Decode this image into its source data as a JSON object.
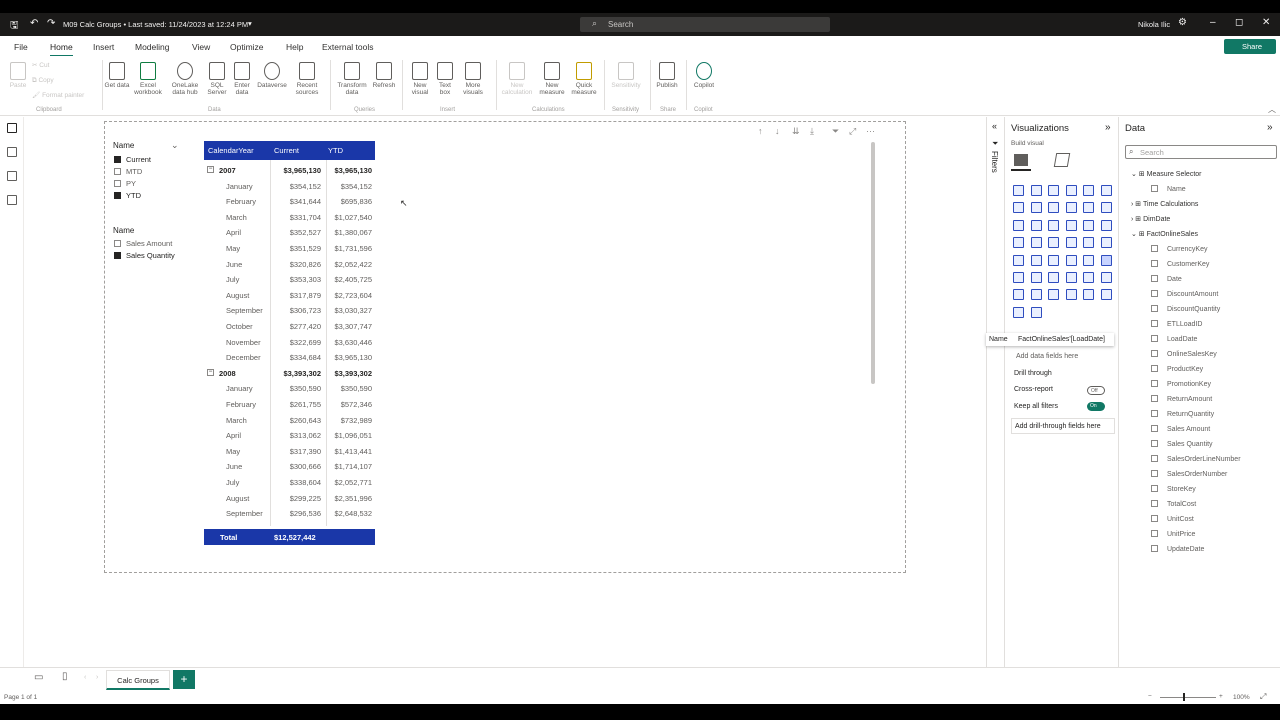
{
  "titlebar": {
    "file_title": "M09 Calc Groups • Last saved: 11/24/2023 at 12:24 PM",
    "search_placeholder": "Search",
    "user_name": "Nikola Ilic"
  },
  "menu": {
    "items": [
      "File",
      "Home",
      "Insert",
      "Modeling",
      "View",
      "Optimize",
      "Help",
      "External tools"
    ],
    "active": "Home",
    "share_label": "Share"
  },
  "ribbon": {
    "clipboard": {
      "paste": "Paste",
      "cut": "Cut",
      "copy": "Copy",
      "format_painter": "Format painter",
      "group": "Clipboard"
    },
    "data": {
      "items": [
        "Get data",
        "Excel workbook",
        "OneLake data hub",
        "SQL Server",
        "Enter data",
        "Dataverse",
        "Recent sources"
      ],
      "group": "Data"
    },
    "queries": {
      "items": [
        "Transform data",
        "Refresh"
      ],
      "group": "Queries"
    },
    "insert": {
      "items": [
        "New visual",
        "Text box",
        "More visuals"
      ],
      "group": "Insert"
    },
    "calculations": {
      "items": [
        "New calculation",
        "New measure",
        "Quick measure"
      ],
      "group": "Calculations"
    },
    "sensitivity": {
      "items": [
        "Sensitivity"
      ],
      "group": "Sensitivity"
    },
    "share": {
      "items": [
        "Publish"
      ],
      "group": "Share"
    },
    "copilot": {
      "items": [
        "Copilot"
      ],
      "group": "Copilot"
    }
  },
  "slicers": {
    "measure": {
      "title": "Name",
      "items": [
        {
          "label": "Current",
          "checked": true
        },
        {
          "label": "MTD",
          "checked": false
        },
        {
          "label": "PY",
          "checked": false
        },
        {
          "label": "YTD",
          "checked": true
        }
      ]
    },
    "value": {
      "title": "Name",
      "items": [
        {
          "label": "Sales Amount",
          "checked": false
        },
        {
          "label": "Sales Quantity",
          "checked": true
        }
      ]
    }
  },
  "matrix": {
    "headers": [
      "CalendarYear",
      "Current",
      "YTD"
    ],
    "header_color": "#1a37a8",
    "rows": [
      {
        "type": "year",
        "label": "2007",
        "current": "$3,965,130",
        "ytd": "$3,965,130"
      },
      {
        "type": "month",
        "label": "January",
        "current": "$354,152",
        "ytd": "$354,152"
      },
      {
        "type": "month",
        "label": "February",
        "current": "$341,644",
        "ytd": "$695,836"
      },
      {
        "type": "month",
        "label": "March",
        "current": "$331,704",
        "ytd": "$1,027,540"
      },
      {
        "type": "month",
        "label": "April",
        "current": "$352,527",
        "ytd": "$1,380,067"
      },
      {
        "type": "month",
        "label": "May",
        "current": "$351,529",
        "ytd": "$1,731,596"
      },
      {
        "type": "month",
        "label": "June",
        "current": "$320,826",
        "ytd": "$2,052,422"
      },
      {
        "type": "month",
        "label": "July",
        "current": "$353,303",
        "ytd": "$2,405,725"
      },
      {
        "type": "month",
        "label": "August",
        "current": "$317,879",
        "ytd": "$2,723,604"
      },
      {
        "type": "month",
        "label": "September",
        "current": "$306,723",
        "ytd": "$3,030,327"
      },
      {
        "type": "month",
        "label": "October",
        "current": "$277,420",
        "ytd": "$3,307,747"
      },
      {
        "type": "month",
        "label": "November",
        "current": "$322,699",
        "ytd": "$3,630,446"
      },
      {
        "type": "month",
        "label": "December",
        "current": "$334,684",
        "ytd": "$3,965,130"
      },
      {
        "type": "year",
        "label": "2008",
        "current": "$3,393,302",
        "ytd": "$3,393,302"
      },
      {
        "type": "month",
        "label": "January",
        "current": "$350,590",
        "ytd": "$350,590"
      },
      {
        "type": "month",
        "label": "February",
        "current": "$261,755",
        "ytd": "$572,346"
      },
      {
        "type": "month",
        "label": "March",
        "current": "$260,643",
        "ytd": "$732,989"
      },
      {
        "type": "month",
        "label": "April",
        "current": "$313,062",
        "ytd": "$1,096,051"
      },
      {
        "type": "month",
        "label": "May",
        "current": "$317,390",
        "ytd": "$1,413,441"
      },
      {
        "type": "month",
        "label": "June",
        "current": "$300,666",
        "ytd": "$1,714,107"
      },
      {
        "type": "month",
        "label": "July",
        "current": "$338,604",
        "ytd": "$2,052,771"
      },
      {
        "type": "month",
        "label": "August",
        "current": "$299,225",
        "ytd": "$2,351,996"
      },
      {
        "type": "month",
        "label": "September",
        "current": "$296,536",
        "ytd": "$2,648,532"
      }
    ],
    "total": {
      "label": "Total",
      "current": "$12,527,442"
    }
  },
  "filters_label": "Filters",
  "visualizations": {
    "title": "Visualizations",
    "build_visual": "Build visual",
    "tooltip_name": "Name",
    "tooltip_value": "FactOnlineSales'[LoadDate]",
    "add_data_fields": "Add data fields here",
    "drill_through": "Drill through",
    "cross_report": "Cross-report",
    "cross_report_state": "Off",
    "keep_all_filters": "Keep all filters",
    "keep_all_filters_state": "On",
    "add_drill_fields": "Add drill-through fields here"
  },
  "data_pane": {
    "title": "Data",
    "search_placeholder": "Search",
    "tables": [
      {
        "name": "Measure Selector",
        "expanded": true,
        "fields": [
          "Name"
        ]
      },
      {
        "name": "Time Calculations",
        "expanded": false,
        "fields": []
      },
      {
        "name": "DimDate",
        "expanded": false,
        "fields": []
      },
      {
        "name": "FactOnlineSales",
        "expanded": true,
        "fields": [
          "CurrencyKey",
          "CustomerKey",
          "Date",
          "DiscountAmount",
          "DiscountQuantity",
          "ETLLoadID",
          "LoadDate",
          "OnlineSalesKey",
          "ProductKey",
          "PromotionKey",
          "ReturnAmount",
          "ReturnQuantity",
          "Sales Amount",
          "Sales Quantity",
          "SalesOrderLineNumber",
          "SalesOrderNumber",
          "StoreKey",
          "TotalCost",
          "UnitCost",
          "UnitPrice",
          "UpdateDate"
        ]
      }
    ]
  },
  "pages": {
    "current": "Calc Groups",
    "status": "Page 1 of 1",
    "zoom": "100%"
  }
}
